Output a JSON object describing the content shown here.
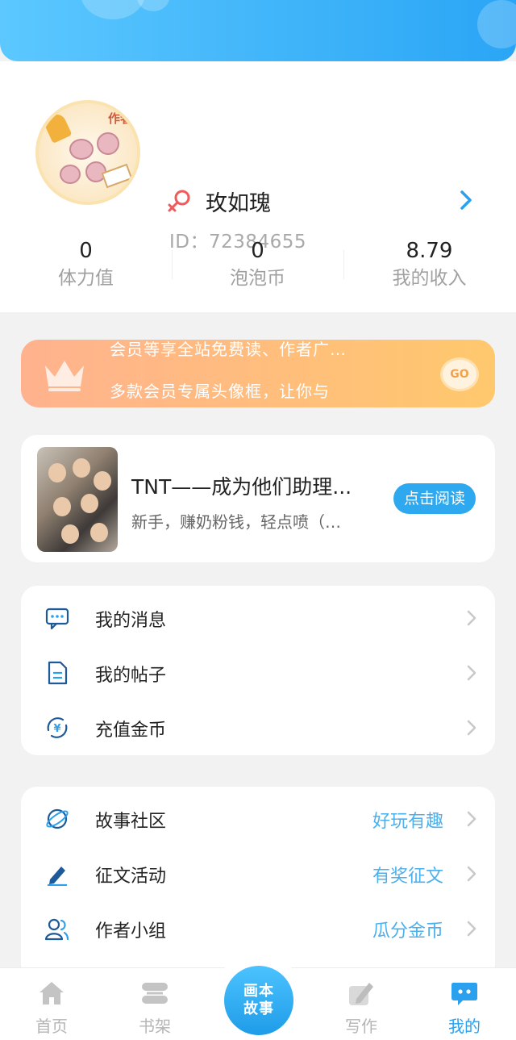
{
  "profile": {
    "nickname": "玫如瑰",
    "user_id": "ID：72384655",
    "avatar_tag": "作者"
  },
  "stats": [
    {
      "value": "0",
      "label": "体力值"
    },
    {
      "value": "0",
      "label": "泡泡币"
    },
    {
      "value": "8.79",
      "label": "我的收入"
    }
  ],
  "vip_banner": {
    "line1": "会员等享全站免费读、作者广…",
    "line2": "多款会员专属头像框，让你与",
    "go_label": "GO"
  },
  "book": {
    "title": "TNT——成为他们助理...",
    "desc": "新手，赚奶粉钱，轻点喷（…",
    "read_label": "点击阅读"
  },
  "menu1": [
    {
      "label": "我的消息",
      "icon": "message-icon"
    },
    {
      "label": "我的帖子",
      "icon": "document-icon"
    },
    {
      "label": "充值金币",
      "icon": "yuan-coin-icon"
    }
  ],
  "menu2": [
    {
      "label": "故事社区",
      "extra": "好玩有趣",
      "icon": "planet-icon"
    },
    {
      "label": "征文活动",
      "extra": "有奖征文",
      "icon": "pen-icon"
    },
    {
      "label": "作者小组",
      "extra": "瓜分金币",
      "icon": "group-icon"
    }
  ],
  "nav": {
    "home": "首页",
    "shelf": "书架",
    "center": [
      "画本",
      "故事"
    ],
    "write": "写作",
    "mine": "我的"
  },
  "colors": {
    "accent": "#2aa0ee",
    "banner_start": "#5cc8ff",
    "banner_end": "#2aa5f5",
    "vip_start": "#ffb28e",
    "vip_end": "#ffc86d"
  }
}
